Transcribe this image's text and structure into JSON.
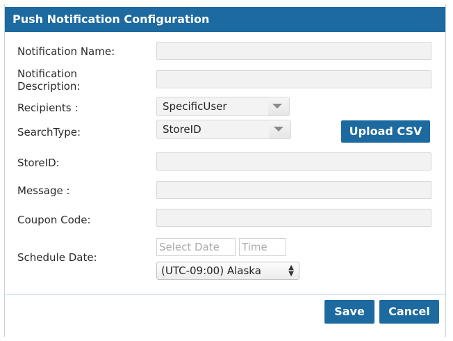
{
  "dialog": {
    "title": "Push Notification Configuration"
  },
  "form": {
    "notification_name_label": "Notification Name:",
    "notification_name_value": "",
    "notification_description_label_line1": "Notification",
    "notification_description_label_line2": "Description:",
    "notification_description_value": "",
    "recipients_label": "Recipients :",
    "recipients_selected": "SpecificUser",
    "search_type_label": "SearchType:",
    "search_type_selected": "StoreID",
    "upload_csv_label": "Upload CSV",
    "store_id_label": "StoreID:",
    "store_id_value": "",
    "message_label": "Message :",
    "message_value": "",
    "coupon_code_label": "Coupon Code:",
    "coupon_code_value": "",
    "schedule_date_label": "Schedule Date:",
    "date_placeholder": "Select Date",
    "time_placeholder": "Time",
    "timezone_selected": "(UTC-09:00) Alaska"
  },
  "footer": {
    "save_label": "Save",
    "cancel_label": "Cancel"
  },
  "colors": {
    "accent": "#1d6aa0",
    "field_background": "#f2f2f2"
  },
  "icons": {
    "dropdown": "chevron-down-icon",
    "select_arrows": "updown-arrows-icon"
  }
}
